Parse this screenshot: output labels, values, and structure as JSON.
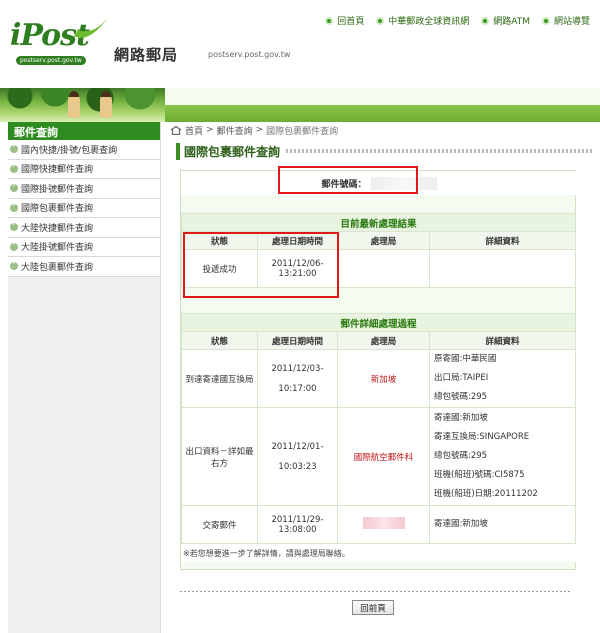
{
  "header": {
    "logo_text": "iPost",
    "logo_sub": "postserv.post.gov.tw",
    "site_title": "網路郵局",
    "site_url": "postserv.post.gov.tw",
    "nav": [
      {
        "label": "回首頁"
      },
      {
        "label": "中華郵政全球資訊網"
      },
      {
        "label": "網路ATM"
      },
      {
        "label": "網站導覽"
      }
    ]
  },
  "sidebar": {
    "title": "郵件查詢",
    "items": [
      {
        "label": "國內快捷/掛號/包裹查詢"
      },
      {
        "label": "國際快捷郵件查詢"
      },
      {
        "label": "國際掛號郵件查詢"
      },
      {
        "label": "國際包裹郵件查詢"
      },
      {
        "label": "大陸快捷郵件查詢"
      },
      {
        "label": "大陸掛號郵件查詢"
      },
      {
        "label": "大陸包裹郵件查詢"
      }
    ]
  },
  "breadcrumb": {
    "home": "首頁",
    "sep": ">",
    "level1": "郵件查詢",
    "current": "國際包裹郵件查詢"
  },
  "page_title": "國際包裹郵件查詢",
  "mail_number_label": "郵件號碼：",
  "latest": {
    "section_title": "目前最新處理結果",
    "headers": [
      "狀態",
      "處理日期時間",
      "處理局",
      "詳細資料"
    ],
    "row": {
      "status": "投遞成功",
      "date": "2011/12/06-",
      "time": "13:21:00",
      "office": "",
      "details": ""
    }
  },
  "history": {
    "section_title": "郵件詳細處理過程",
    "headers": [
      "狀態",
      "處理日期時間",
      "處理局",
      "詳細資料"
    ],
    "rows": [
      {
        "status": "到達寄達國互換局",
        "date": "2011/12/03-",
        "time": "10:17:00",
        "office": "新加坡",
        "details": [
          "原寄國:中華民國",
          "出口局:TAIPEI",
          "總包號碼:295"
        ]
      },
      {
        "status": "出口資料－詳如最右方",
        "date": "2011/12/01-",
        "time": "10:03:23",
        "office": "國際航空郵件科",
        "details": [
          "寄達國:新加坡",
          "寄達互換局:SINGAPORE",
          "總包號碼:295",
          "班機(船班)號碼:CI5875",
          "班機(船班)日期:20111202"
        ]
      },
      {
        "status": "交寄郵件",
        "date": "2011/11/29-",
        "time": "13:08:00",
        "office": "",
        "details": [
          "寄達國:新加坡"
        ]
      }
    ]
  },
  "note": "※若您想要進一步了解詳情，請與處理局聯絡。",
  "back_button": "回前頁",
  "colors": {
    "brand_green": "#2e8b1f",
    "accent_red": "#c0171a"
  }
}
